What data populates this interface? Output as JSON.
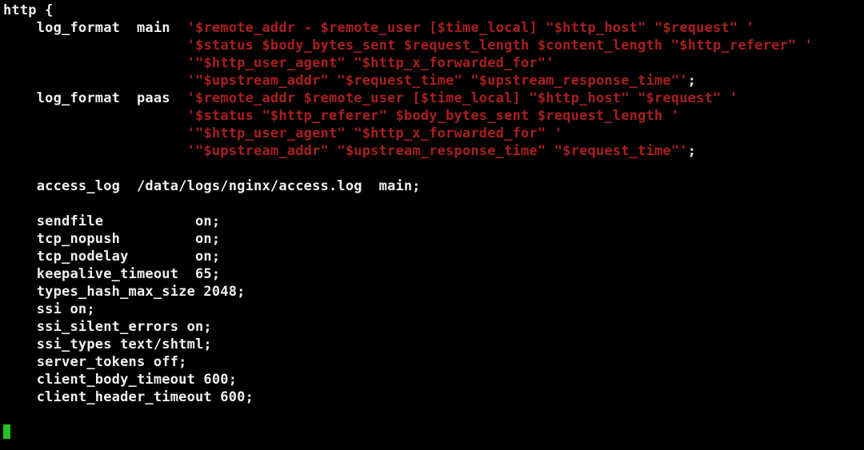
{
  "config": {
    "http_open": "http {",
    "lf_main_key": "    log_format  main  ",
    "lf_main_l1": "'$remote_addr - $remote_user [$time_local] \"$http_host\" \"$request\" '",
    "lf_main_l2i": "                      ",
    "lf_main_l2": "'$status $body_bytes_sent $request_length $content_length \"$http_referer\" '",
    "lf_main_l3i": "                      ",
    "lf_main_l3": "'\"$http_user_agent\" \"$http_x_forwarded_for\"'",
    "lf_main_l4i": "                      ",
    "lf_main_l4": "'\"$upstream_addr\" \"$request_time\" \"$upstream_response_time\"'",
    "lf_main_end": ";",
    "lf_paas_key": "    log_format  paas  ",
    "lf_paas_l1": "'$remote_addr $remote_user [$time_local] \"$http_host\" \"$request\" '",
    "lf_paas_l2i": "                      ",
    "lf_paas_l2": "'$status \"$http_referer\" $body_bytes_sent $request_length '",
    "lf_paas_l3i": "                      ",
    "lf_paas_l3": "'\"$http_user_agent\" \"$http_x_forwarded_for\" '",
    "lf_paas_l4i": "                      ",
    "lf_paas_l4": "'\"$upstream_addr\" \"$upstream_response_time\" \"$request_time\"'",
    "lf_paas_end": ";",
    "access_log": "    access_log  /data/logs/nginx/access.log  main;",
    "d_sendfile": "    sendfile           on;",
    "d_tcp_nopush": "    tcp_nopush         on;",
    "d_tcp_nodelay": "    tcp_nodelay        on;",
    "d_keepalive_timeout": "    keepalive_timeout  65;",
    "d_types_hash_max_size": "    types_hash_max_size 2048;",
    "d_ssi": "    ssi on;",
    "d_ssi_silent_errors": "    ssi_silent_errors on;",
    "d_ssi_types": "    ssi_types text/shtml;",
    "d_server_tokens": "    server_tokens off;",
    "d_client_body_timeout": "    client_body_timeout 600;",
    "d_client_header_timeout": "    client_header_timeout 600;"
  }
}
